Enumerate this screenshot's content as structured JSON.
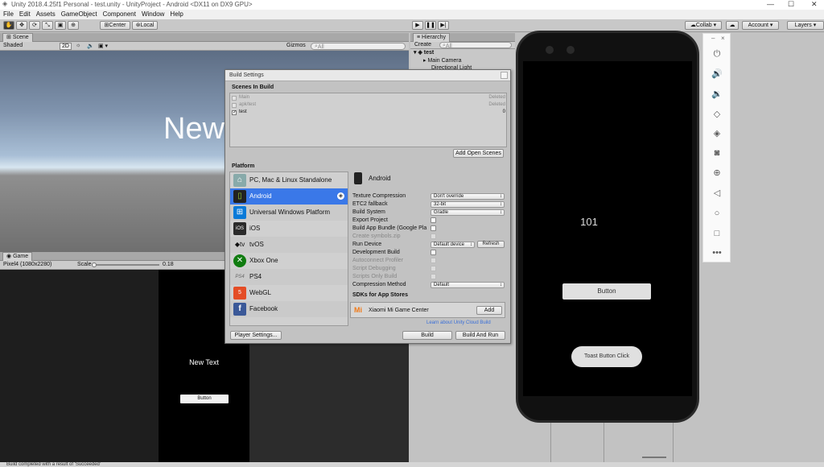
{
  "window": {
    "title": "Unity 2018.4.25f1 Personal - test.unity - UnityProject - Android <DX11 on DX9 GPU>"
  },
  "menu": [
    "File",
    "Edit",
    "Assets",
    "GameObject",
    "Component",
    "Window",
    "Help"
  ],
  "toolbar": {
    "center": "Center",
    "local": "Local",
    "collab": "Collab",
    "account": "Account",
    "layers": "Layers"
  },
  "scene": {
    "tab": "Scene",
    "shaded": "Shaded",
    "mode2d": "2D",
    "gizmos": "Gizmos",
    "search": "All",
    "overlay_text": "New"
  },
  "game": {
    "tab": "Game",
    "device": "Pixel4 (1080x2280)",
    "scale_label": "Scale",
    "scale_value": "0.18",
    "text": "New Text",
    "button": "Button"
  },
  "hierarchy": {
    "tab": "Hierarchy",
    "create": "Create",
    "search": "All",
    "root": "test",
    "items": [
      "Main Camera",
      "Directional Light"
    ]
  },
  "build_settings": {
    "title": "Build Settings",
    "scenes_header": "Scenes In Build",
    "scenes": [
      {
        "name": "Main",
        "status": "Deleted",
        "checked": false
      },
      {
        "name": "apk/test",
        "status": "Deleted",
        "checked": false
      },
      {
        "name": "test",
        "status": "0",
        "checked": true
      }
    ],
    "add_open_scenes": "Add Open Scenes",
    "platform_header": "Platform",
    "platforms": [
      "PC, Mac & Linux Standalone",
      "Android",
      "Universal Windows Platform",
      "iOS",
      "tvOS",
      "Xbox One",
      "PS4",
      "WebGL",
      "Facebook"
    ],
    "selected_platform": "Android",
    "settings": [
      {
        "label": "Texture Compression",
        "value": "Don't override"
      },
      {
        "label": "ETC2 fallback",
        "value": "32-bit"
      },
      {
        "label": "Build System",
        "value": "Gradle"
      },
      {
        "label": "Export Project"
      },
      {
        "label": "Build App Bundle (Google Pla"
      },
      {
        "label": "Create symbols.zip"
      },
      {
        "label": "Run Device",
        "value": "Default device"
      },
      {
        "label": "Development Build"
      },
      {
        "label": "Autoconnect Profiler"
      },
      {
        "label": "Script Debugging"
      },
      {
        "label": "Scripts Only Build"
      },
      {
        "label": "Compression Method",
        "value": "Default"
      }
    ],
    "refresh": "Refresh",
    "sdk_header": "SDKs for App Stores",
    "sdk_name": "Xiaomi Mi Game Center",
    "sdk_add": "Add",
    "cloud_link": "Learn about Unity Cloud Build",
    "player_settings": "Player Settings...",
    "build": "Build",
    "build_and_run": "Build And Run"
  },
  "emulator": {
    "counter": "101",
    "button": "Button",
    "toast_button": "Toast Button Click"
  },
  "status": {
    "message": "Build completed with a result of 'Succeeded'"
  },
  "colors": {
    "selection": "#3a78e8",
    "sdk_orange": "#f07a18",
    "link": "#3a6fd8"
  }
}
